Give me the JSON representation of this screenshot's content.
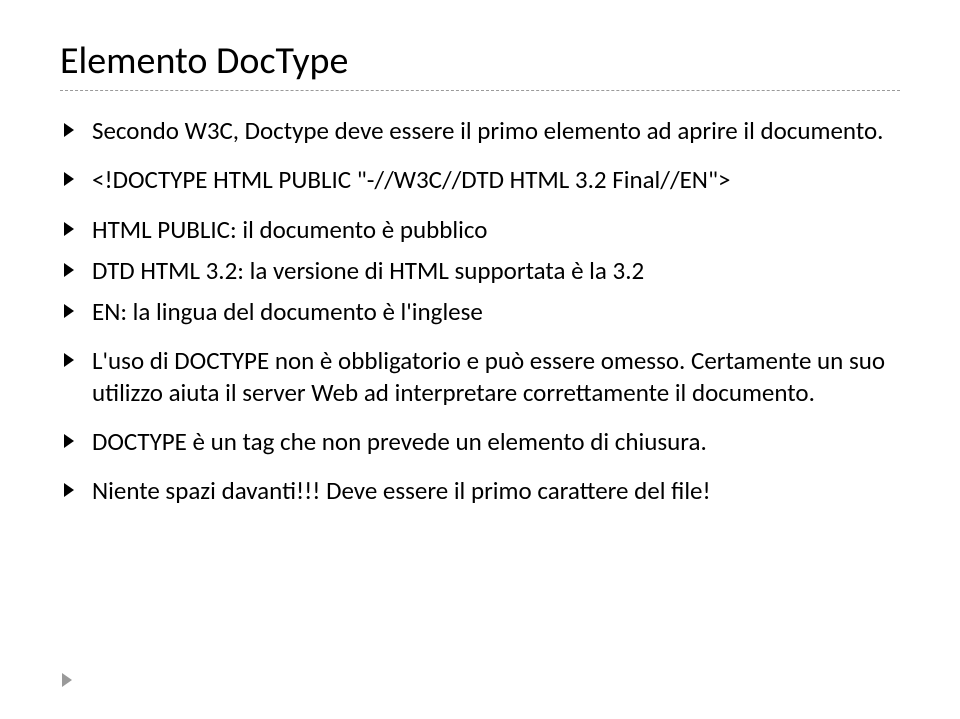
{
  "title": "Elemento DocType",
  "bullets": {
    "b1": "Secondo W3C, Doctype deve essere il primo elemento ad aprire il documento.",
    "b2": "<!DOCTYPE HTML PUBLIC \"-//W3C//DTD HTML 3.2 Final//EN\">",
    "b3": "HTML PUBLIC: il documento è pubblico",
    "b4": "DTD HTML 3.2: la versione di HTML supportata è la 3.2",
    "b5": "EN: la lingua del documento è l'inglese",
    "b6": "L'uso di DOCTYPE non è obbligatorio e può essere omesso. Certamente un suo utilizzo aiuta il server Web ad interpretare correttamente il documento.",
    "b7": "DOCTYPE è un tag che non prevede un elemento di chiusura.",
    "b8": "Niente spazi davanti!!! Deve essere il primo carattere del file!"
  }
}
